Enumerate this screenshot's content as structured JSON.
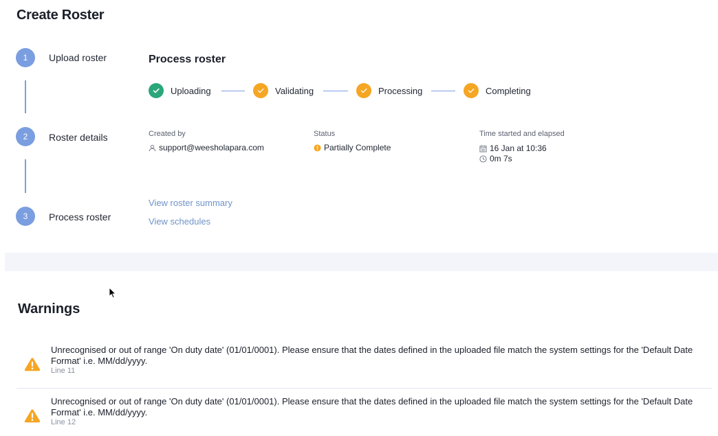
{
  "page": {
    "title": "Create Roster"
  },
  "steps": [
    {
      "number": "1",
      "label": "Upload roster"
    },
    {
      "number": "2",
      "label": "Roster details"
    },
    {
      "number": "3",
      "label": "Process roster"
    }
  ],
  "process": {
    "title": "Process roster",
    "stages": [
      {
        "label": "Uploading",
        "state": "done",
        "color": "#2aa77a"
      },
      {
        "label": "Validating",
        "state": "warning",
        "color": "#f5a623"
      },
      {
        "label": "Processing",
        "state": "warning",
        "color": "#f5a623"
      },
      {
        "label": "Completing",
        "state": "warning",
        "color": "#f5a623"
      }
    ],
    "created_by": {
      "label": "Created by",
      "value": "support@weesholapara.com",
      "icon": "user-icon"
    },
    "status": {
      "label": "Status",
      "value": "Partially Complete",
      "icon": "info-icon",
      "color": "#f5a623"
    },
    "time": {
      "label": "Time started and elapsed",
      "started": "16 Jan at 10:36",
      "elapsed": "0m 7s",
      "started_icon": "calendar-icon",
      "elapsed_icon": "clock-icon"
    },
    "links": {
      "summary": "View roster summary",
      "schedules": "View schedules"
    }
  },
  "warnings": {
    "title": "Warnings",
    "items": [
      {
        "message": "Unrecognised or out of range 'On duty date' (01/01/0001). Please ensure that the dates defined in the uploaded file match the system settings for the 'Default Date Format' i.e. MM/dd/yyyy.",
        "line": "Line 11"
      },
      {
        "message": "Unrecognised or out of range 'On duty date' (01/01/0001). Please ensure that the dates defined in the uploaded file match the system settings for the 'Default Date Format' i.e. MM/dd/yyyy.",
        "line": "Line 12"
      }
    ]
  },
  "colors": {
    "accent": "#7a9ee0",
    "link": "#6f93c8",
    "success": "#2aa77a",
    "warning": "#f5a623"
  }
}
